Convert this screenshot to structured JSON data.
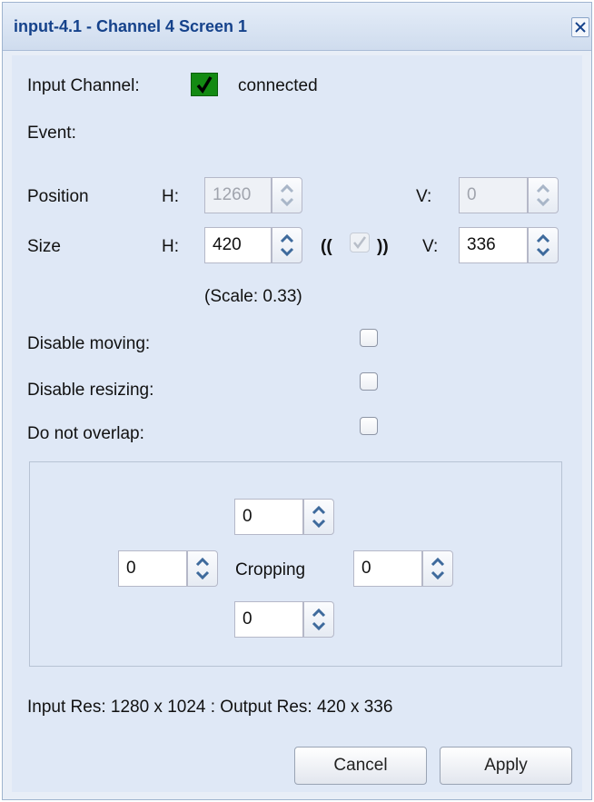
{
  "dialog": {
    "title": "input-4.1 - Channel 4 Screen 1"
  },
  "input_channel": {
    "label": "Input Channel:",
    "status": "connected",
    "status_color": "#138a13"
  },
  "event": {
    "label": "Event:"
  },
  "position": {
    "label": "Position",
    "h_label": "H:",
    "h_value": "1260",
    "v_label": "V:",
    "v_value": "0",
    "disabled": true
  },
  "size": {
    "label": "Size",
    "h_label": "H:",
    "h_value": "420",
    "lock_open": "((",
    "lock_close": "))",
    "v_label": "V:",
    "v_value": "336",
    "scale_text": "(Scale: 0.33)"
  },
  "options": {
    "disable_moving": "Disable moving:",
    "disable_resizing": "Disable resizing:",
    "do_not_overlap": "Do not overlap:"
  },
  "cropping": {
    "label": "Cropping",
    "top": "0",
    "left": "0",
    "right": "0",
    "bottom": "0"
  },
  "resolution": {
    "text": "Input Res: 1280 x 1024 :  Output Res: 420 x 336"
  },
  "buttons": {
    "cancel": "Cancel",
    "apply": "Apply"
  },
  "icons": {
    "close": "close-icon",
    "check": "checkmark-icon",
    "spinner": "spinner-arrows-icon"
  },
  "colors": {
    "title": "#15428b",
    "panel_bg": "#dfe8f6",
    "accent_green": "#138a13"
  }
}
